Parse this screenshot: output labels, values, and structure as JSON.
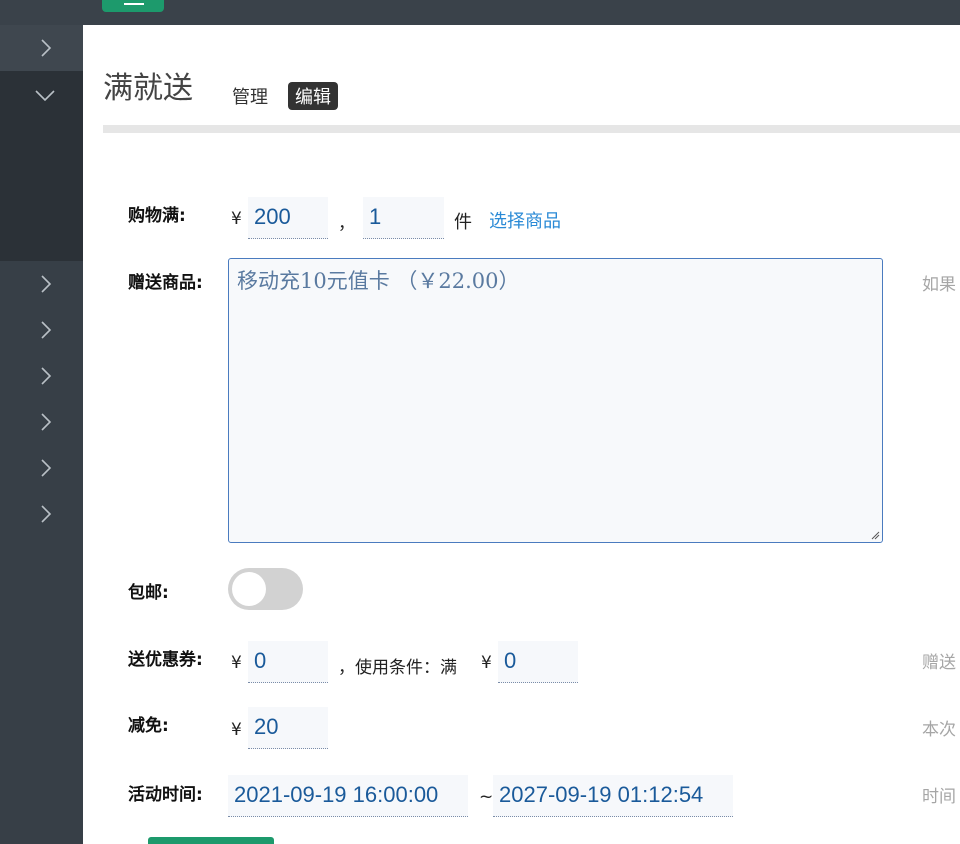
{
  "page": {
    "title": "满就送"
  },
  "tabs": [
    {
      "label": "管理",
      "active": false
    },
    {
      "label": "编辑",
      "active": true
    }
  ],
  "form": {
    "shopping_full": {
      "label": "购物满:",
      "currency": "¥",
      "amount": "200",
      "separator": "，",
      "quantity": "1",
      "unit": "件",
      "select_link": "选择商品"
    },
    "gift_goods": {
      "label": "赠送商品:",
      "value": "移动充10元值卡 （￥22.00）",
      "hint": "如果"
    },
    "free_shipping": {
      "label": "包邮:",
      "enabled": false
    },
    "coupon": {
      "label": "送优惠券:",
      "currency": "¥",
      "amount": "0",
      "condition_text": "，使用条件：满",
      "condition_currency": "¥",
      "condition_amount": "0",
      "hint": "赠送"
    },
    "discount": {
      "label": "减免:",
      "currency": "¥",
      "amount": "20",
      "hint": "本次"
    },
    "activity_time": {
      "label": "活动时间:",
      "start": "2021-09-19 16:00:00",
      "separator": "~",
      "end": "2027-09-19 01:12:54",
      "hint": "时间"
    }
  },
  "colors": {
    "primary": "#1d9a6c",
    "sidebar": "#373f47",
    "topbar": "#3a424a",
    "link": "#2a8ad6"
  },
  "icons": {
    "sidebar_collapsed": "chevron-right-icon",
    "sidebar_expanded": "chevron-down-icon",
    "menu_toggle": "hamburger-icon"
  }
}
